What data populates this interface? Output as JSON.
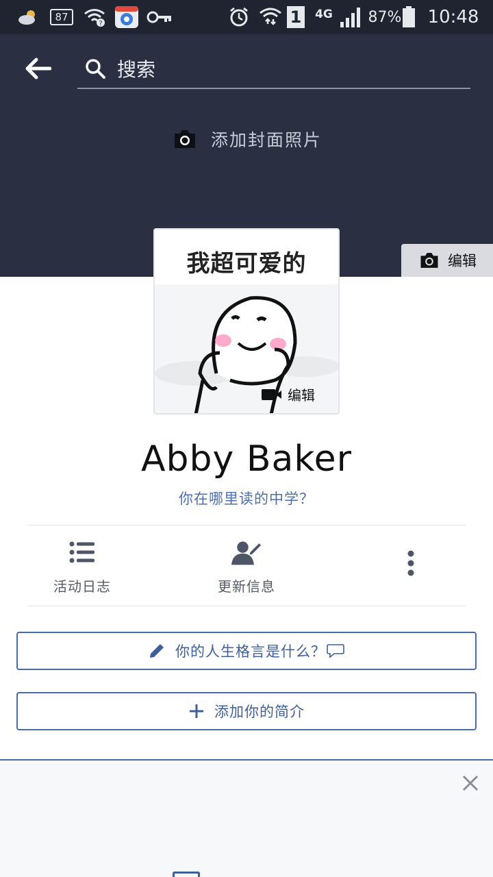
{
  "status_bar": {
    "notification_count": "87",
    "network": "4G",
    "sim_slot": "1",
    "battery": "87%",
    "time": "10:48"
  },
  "header": {
    "search_label": "搜索"
  },
  "cover": {
    "add_cover_label": "添加封面照片",
    "edit_label": "编辑"
  },
  "profile_picture": {
    "caption": "我超可爱的",
    "edit_label": "编辑"
  },
  "profile": {
    "name": "Abby Baker",
    "school_prompt": "你在哪里读的中学？"
  },
  "actions": {
    "activity_log": "活动日志",
    "update_info": "更新信息"
  },
  "prompts": {
    "motto": "你的人生格言是什么？",
    "add_bio": "添加你的简介"
  },
  "colors": {
    "header_bg": "#2a3042",
    "accent": "#4b6aa3",
    "link": "#4b6fb0"
  }
}
